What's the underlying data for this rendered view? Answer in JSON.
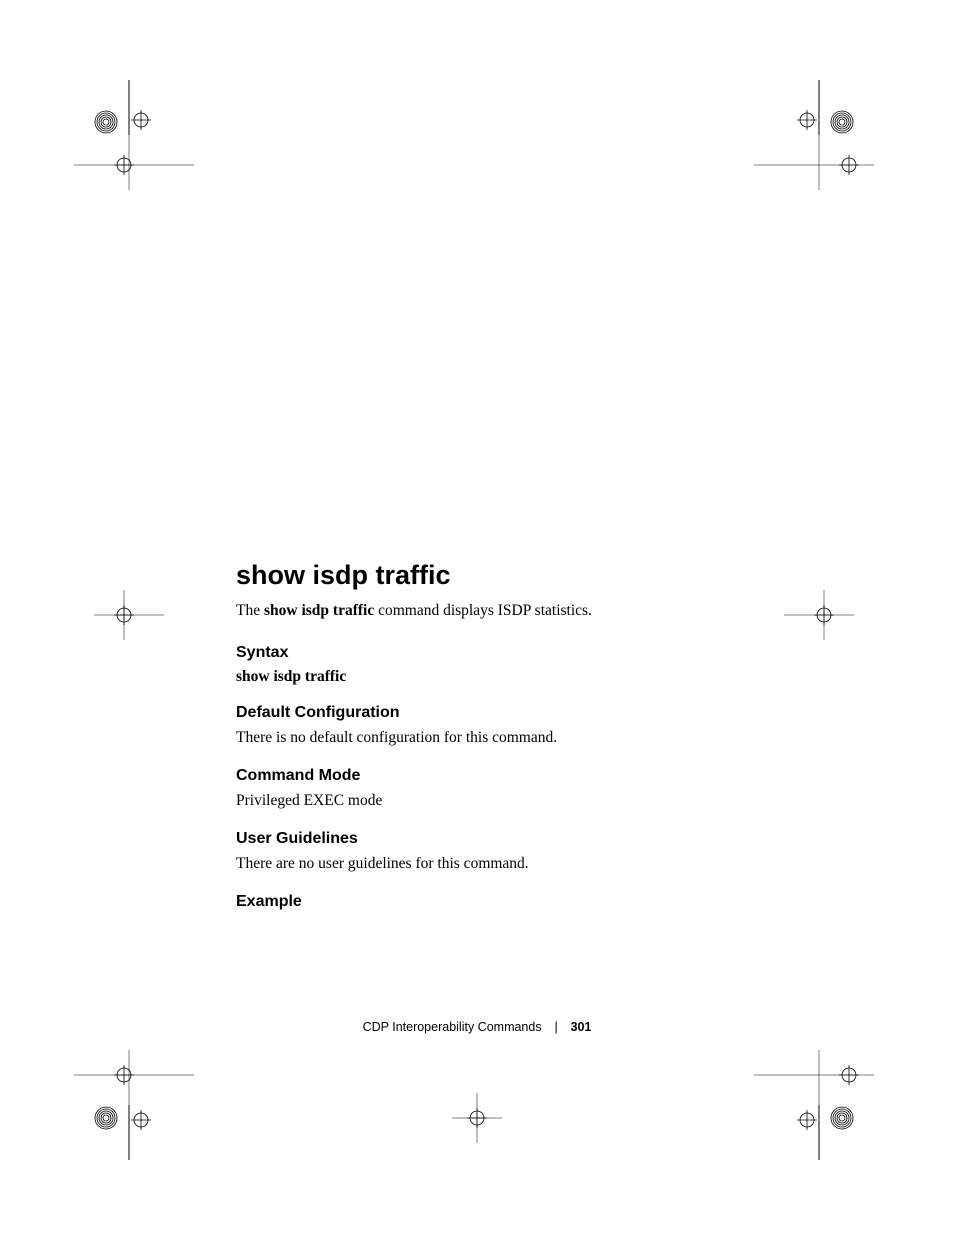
{
  "title": "show isdp traffic",
  "description_prefix": "The ",
  "description_bold": "show isdp traffic",
  "description_suffix": " command displays ISDP statistics.",
  "sections": {
    "syntax": {
      "heading": "Syntax",
      "body": "show isdp traffic"
    },
    "default_config": {
      "heading": "Default Configuration",
      "body": "There is no default configuration for this command."
    },
    "command_mode": {
      "heading": "Command Mode",
      "body": "Privileged EXEC mode"
    },
    "user_guidelines": {
      "heading": "User Guidelines",
      "body": "There are no user guidelines for this command."
    },
    "example": {
      "heading": "Example"
    }
  },
  "footer": {
    "chapter": "CDP Interoperability Commands",
    "separator": "|",
    "page_number": "301"
  }
}
